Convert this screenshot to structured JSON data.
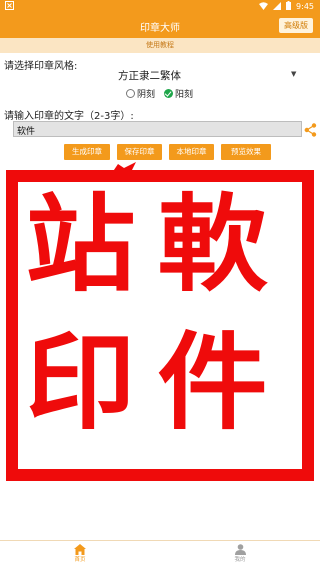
{
  "status_bar": {
    "left_icon": "app-notification-icon",
    "time": "9:45"
  },
  "app_bar": {
    "title": "印章大师",
    "pro_button": "高级版"
  },
  "tutorial_link": "使用教程",
  "style_section": {
    "label": "请选择印章风格:",
    "selected_font": "方正隶二繁体",
    "radios": [
      {
        "label": "阴刻",
        "checked": false
      },
      {
        "label": "阳刻",
        "checked": true
      }
    ]
  },
  "text_section": {
    "label": "请输入印章的文字（2-3字）:",
    "value": "软件"
  },
  "buttons": [
    "生成印章",
    "保存印章",
    "本地印章",
    "预览效果"
  ],
  "seal": {
    "characters": [
      "軟",
      "件",
      "站",
      "印"
    ],
    "color": "#ef0b0b"
  },
  "bottom_nav": [
    {
      "label": "首页",
      "icon": "home-icon",
      "active": true
    },
    {
      "label": "我的",
      "icon": "person-icon",
      "active": false
    }
  ],
  "colors": {
    "accent": "#f39a1c",
    "tutorial_bg": "#fbe5c3",
    "seal_red": "#ef0b0b",
    "radio_green": "#1fa64a"
  }
}
